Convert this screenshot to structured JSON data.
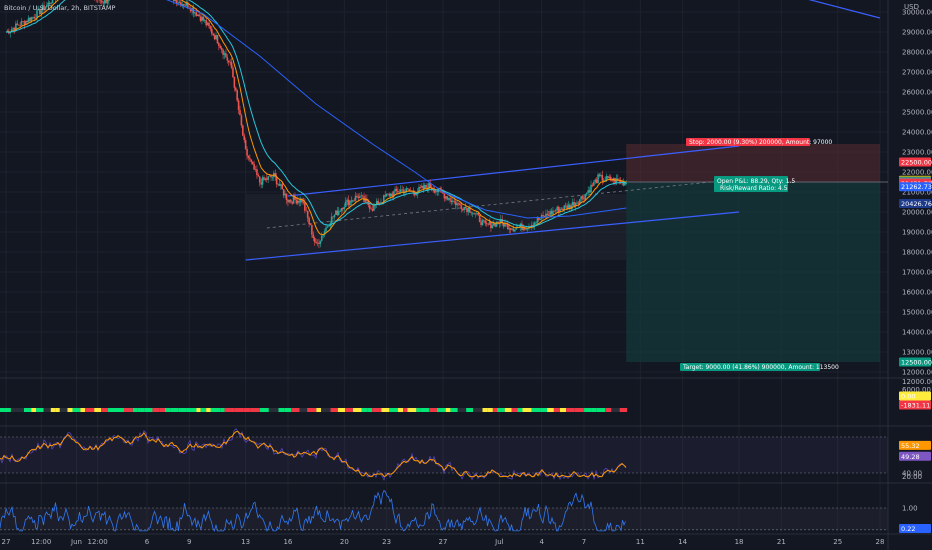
{
  "header": {
    "symbol_title": "Bitcoin / U.S. Dollar, 2h, BITSTAMP",
    "currency": "USD"
  },
  "colors": {
    "background": "#131722",
    "grid": "#1e222d",
    "up": "#26a69a",
    "down": "#ef5350",
    "channel": "#3a5fff",
    "ma_slow": "#2962ff",
    "ma_orange": "#ff9800",
    "ma_teal": "#26c6da",
    "stop_zone": "#5b2b31",
    "target_zone": "#153a3a",
    "rsi": "#ff9800",
    "osc": "#3179f5",
    "stop_tag": "#f23645",
    "target_tag": "#089981"
  },
  "chart_data": [
    {
      "type": "line",
      "title": "",
      "price_axis": {
        "ylim": [
          11800,
          30600
        ],
        "ticks": [
          12000,
          13000,
          14000,
          15000,
          16000,
          17000,
          18000,
          19000,
          20000,
          21000,
          22000,
          23000,
          24000,
          25000,
          26000,
          27000,
          28000,
          29000,
          30000
        ],
        "tick_labels": [
          "12000.00",
          "13000.00",
          "14000.00",
          "15000.00",
          "16000.00",
          "17000.00",
          "18000.00",
          "19000.00",
          "20000.00",
          "21000.00",
          "22000.00",
          "23000.00",
          "24000.00",
          "25000.00",
          "26000.00",
          "27000.00",
          "28000.00",
          "29000.00",
          "30000.00"
        ]
      },
      "time_axis": {
        "range": [
          "2022-05-27",
          "2022-07-28"
        ],
        "ticks": [
          "2022-05-27",
          "2022-05-29 12:00",
          "2022-06-01",
          "2022-06-02 12:00",
          "2022-06-06",
          "2022-06-09",
          "2022-06-13",
          "2022-06-16",
          "2022-06-20",
          "2022-06-23",
          "2022-06-27",
          "2022-07-01",
          "2022-07-04",
          "2022-07-07",
          "2022-07-11",
          "2022-07-14",
          "2022-07-18",
          "2022-07-21",
          "2022-07-25",
          "2022-07-28"
        ],
        "tick_labels": [
          "27",
          "12:00",
          "Jun",
          "12:00",
          "6",
          "9",
          "13",
          "16",
          "20",
          "23",
          "27",
          "Jul",
          "4",
          "7",
          "11",
          "14",
          "18",
          "21",
          "25",
          "28"
        ]
      },
      "price_path": [
        [
          "2022-05-27",
          29000
        ],
        [
          "2022-05-28",
          29400
        ],
        [
          "2022-05-29",
          29800
        ],
        [
          "2022-05-30",
          30400
        ],
        [
          "2022-05-31",
          31200
        ],
        [
          "2022-06-01",
          31500
        ],
        [
          "2022-06-02",
          30800
        ],
        [
          "2022-06-03",
          30500
        ],
        [
          "2022-06-04",
          31200
        ],
        [
          "2022-06-05",
          31400
        ],
        [
          "2022-06-06",
          31000
        ],
        [
          "2022-06-07",
          31400
        ],
        [
          "2022-06-08",
          30600
        ],
        [
          "2022-06-09",
          30300
        ],
        [
          "2022-06-10",
          29600
        ],
        [
          "2022-06-11",
          28600
        ],
        [
          "2022-06-12",
          27200
        ],
        [
          "2022-06-13",
          23000
        ],
        [
          "2022-06-14",
          21500
        ],
        [
          "2022-06-15",
          21800
        ],
        [
          "2022-06-16",
          20600
        ],
        [
          "2022-06-17",
          20600
        ],
        [
          "2022-06-18",
          18300
        ],
        [
          "2022-06-19",
          19600
        ],
        [
          "2022-06-20",
          20400
        ],
        [
          "2022-06-21",
          20800
        ],
        [
          "2022-06-22",
          20200
        ],
        [
          "2022-06-23",
          20800
        ],
        [
          "2022-06-24",
          21100
        ],
        [
          "2022-06-25",
          21000
        ],
        [
          "2022-06-26",
          21300
        ],
        [
          "2022-06-27",
          20900
        ],
        [
          "2022-06-28",
          20400
        ],
        [
          "2022-06-29",
          20100
        ],
        [
          "2022-06-30",
          19300
        ],
        [
          "2022-07-01",
          19500
        ],
        [
          "2022-07-02",
          19200
        ],
        [
          "2022-07-03",
          19300
        ],
        [
          "2022-07-04",
          19700
        ],
        [
          "2022-07-05",
          20100
        ],
        [
          "2022-07-06",
          20300
        ],
        [
          "2022-07-07",
          20800
        ],
        [
          "2022-07-08",
          21700
        ],
        [
          "2022-07-09",
          21600
        ],
        [
          "2022-07-10",
          21450
        ]
      ],
      "channel": {
        "upper": [
          [
            "2022-06-16",
            20800
          ],
          [
            "2022-07-18",
            23300
          ]
        ],
        "lower": [
          [
            "2022-06-13",
            17600
          ],
          [
            "2022-07-18",
            20000
          ]
        ],
        "top_right_line": [
          [
            "2022-07-22",
            30800
          ],
          [
            "2022-07-28",
            29700
          ]
        ]
      },
      "moving_average_slow": [
        [
          "2022-06-06",
          31000
        ],
        [
          "2022-06-10",
          29900
        ],
        [
          "2022-06-14",
          27800
        ],
        [
          "2022-06-18",
          25400
        ],
        [
          "2022-06-22",
          23400
        ],
        [
          "2022-06-25",
          22000
        ],
        [
          "2022-06-27",
          21000
        ],
        [
          "2022-06-30",
          20100
        ],
        [
          "2022-07-03",
          19700
        ],
        [
          "2022-07-06",
          19800
        ],
        [
          "2022-07-10",
          20200
        ]
      ],
      "position": {
        "start": "2022-07-10",
        "end": "2022-07-28",
        "entry": 21500,
        "stop": 23400,
        "target": 12500,
        "stop_label": "Stop: 2000.00 (9.30%) 200000, Amount: 97000",
        "target_label": "Target: 9000.00 (41.86%) 900000, Amount: 113500",
        "info_label_1": "Open P&L: 88.29, Qty: 1.5",
        "info_label_2": "Risk/Reward Ratio: 4.5"
      },
      "price_tags": [
        {
          "value": 22500,
          "label": "22500.00",
          "color": "#f23645"
        },
        {
          "value": 21587.84,
          "label": "21587.84",
          "color": "#d9a900"
        },
        {
          "value": 21534.5,
          "label": "21534.50",
          "color": "#089981"
        },
        {
          "value": 21500,
          "label": "21500.00",
          "color": "#787b86"
        },
        {
          "value": 21431.71,
          "label": "21431.71",
          "color": "#f23645"
        },
        {
          "value": 21262.73,
          "label": "21262.73",
          "color": "#2962ff"
        },
        {
          "value": 20426.76,
          "label": "20426.76",
          "color": "#1e3a8a"
        },
        {
          "value": 12500,
          "label": "12500.00",
          "color": "#089981"
        }
      ]
    },
    {
      "type": "bar",
      "title": "",
      "ylim": [
        -6000,
        6000
      ],
      "tick_labels": [
        "6000.00",
        "12000.00"
      ],
      "tags": [
        {
          "value": 0,
          "label": "0.00",
          "color": "#ffeb3b"
        },
        {
          "value": -1831,
          "label": "-1831.11",
          "color": "#f23645"
        }
      ]
    },
    {
      "type": "line",
      "title": "",
      "ylim": [
        35,
        65
      ],
      "tick_labels": [
        "40.00"
      ],
      "levels": [
        60,
        40
      ],
      "tags": [
        {
          "value": 55.32,
          "label": "55.32",
          "color": "#ff9800"
        },
        {
          "value": 49.28,
          "label": "49.28",
          "color": "#7e57c2"
        }
      ]
    },
    {
      "type": "line",
      "title": "",
      "ylim": [
        -1.2,
        3.2
      ],
      "tick_labels": [
        "20.00",
        "1.00"
      ],
      "levels": [
        1,
        -1
      ],
      "tags": [
        {
          "value": 0.22,
          "label": "0.22",
          "color": "#2962ff"
        }
      ]
    }
  ]
}
